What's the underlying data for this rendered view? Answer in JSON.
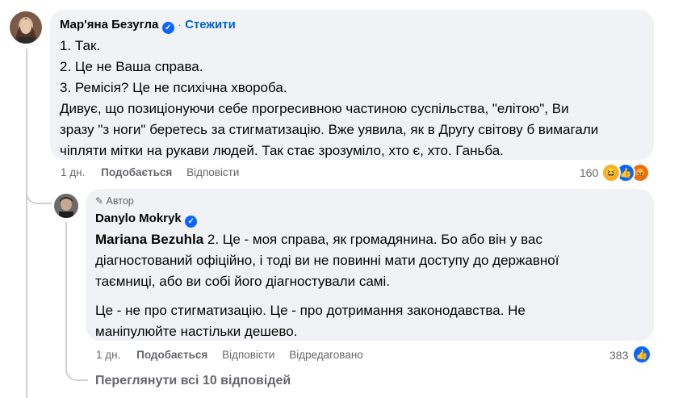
{
  "comment": {
    "author": "Мар'яна Безугла",
    "follow_label": "Стежити",
    "lines": [
      "1. Так.",
      "2. Це не Ваша справа.",
      "3. Ремісія? Це не психічна хвороба.",
      "Дивує, що позиціонуючи себе прогресивною частиною суспільства, \"елітою\", Ви",
      "зразу \"з ноги\" беретесь за стигматизацію. Вже уявила, як в Другу світову б вимагали",
      "чіпляти мітки на рукави людей. Так стає зрозуміло, хто є, хто. Ганьба."
    ],
    "time": "1 дн.",
    "like_label": "Подобається",
    "reply_label": "Відповісти",
    "reaction_count": "160",
    "reactions": [
      "haha-icon",
      "like-icon",
      "angry-icon"
    ]
  },
  "reply": {
    "author_badge": "Автор",
    "author": "Danylo Mokryk",
    "mention": "Mariana Bezuhla",
    "para1_first": " 2. Це - моя справа, як громадянина. Бо або він у вас",
    "para1_lines": [
      "діагностований офіційно, і тоді ви не повинні мати доступу до державної",
      "таємниці, або ви собі його діагностували самі."
    ],
    "para2_lines": [
      "Це - не про стигматизацію. Це - про дотримання законодавства. Не",
      "маніпулюйте настільки дешево."
    ],
    "time": "1 дн.",
    "like_label": "Подобається",
    "reply_label": "Відповісти",
    "edited_label": "Відредаговано",
    "reaction_count": "383",
    "reactions": [
      "like-icon"
    ]
  },
  "view_all_replies": "Переглянути всі 10 відповідей",
  "colors": {
    "bubble": "#f0f2f5",
    "link_blue": "#0064d1",
    "verified_blue": "#0866ff",
    "meta_gray": "#65676b"
  }
}
